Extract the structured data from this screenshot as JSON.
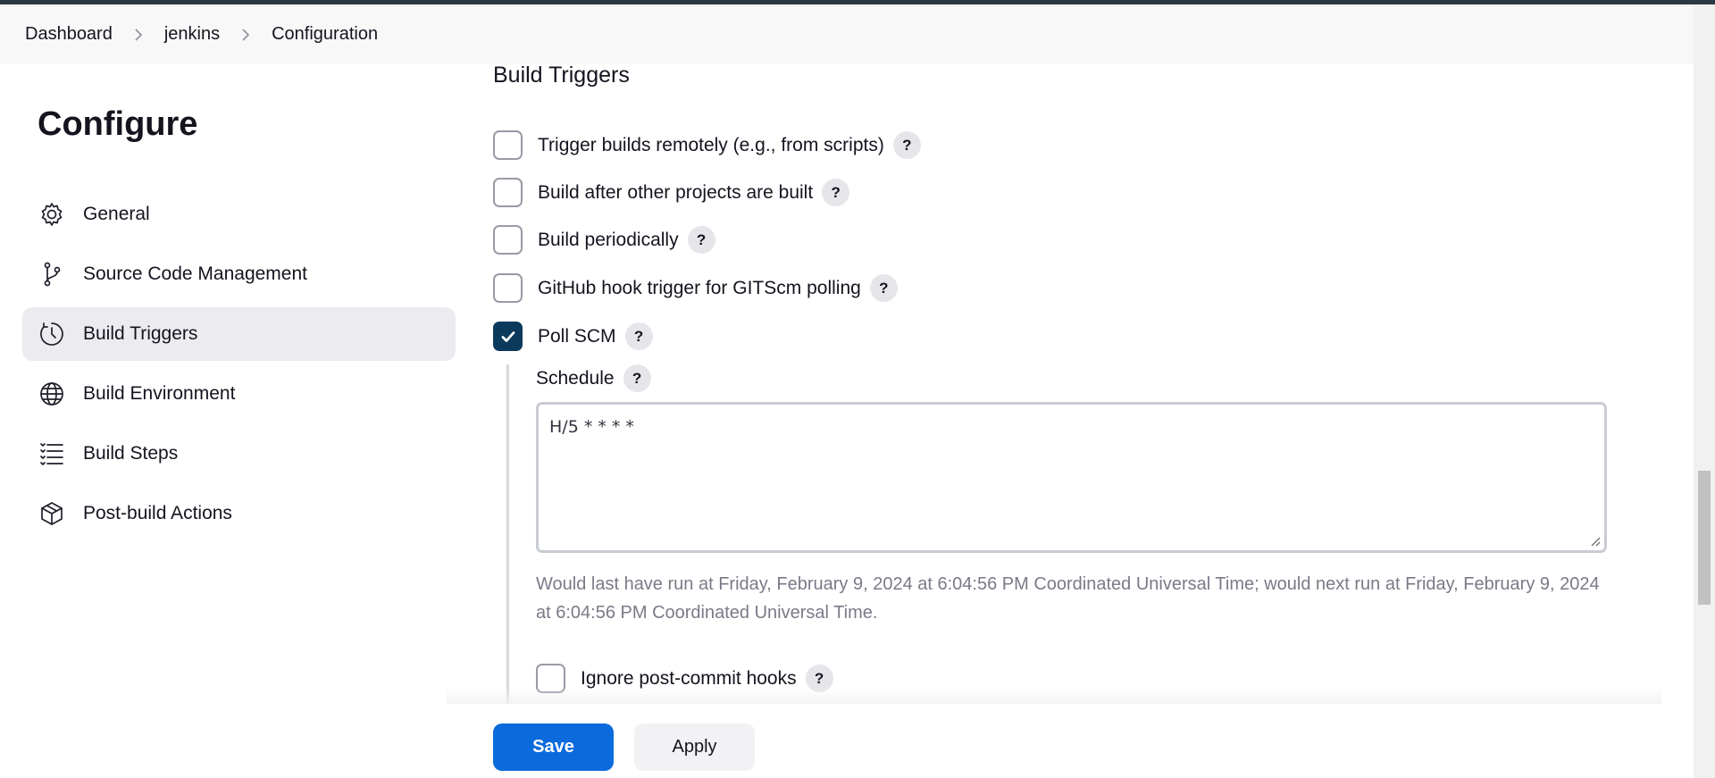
{
  "breadcrumb": {
    "items": [
      "Dashboard",
      "jenkins",
      "Configuration"
    ]
  },
  "sidebar": {
    "title": "Configure",
    "items": [
      {
        "label": "General",
        "icon": "gear-icon",
        "active": false
      },
      {
        "label": "Source Code Management",
        "icon": "branch-icon",
        "active": false
      },
      {
        "label": "Build Triggers",
        "icon": "clock-icon",
        "active": true
      },
      {
        "label": "Build Environment",
        "icon": "globe-icon",
        "active": false
      },
      {
        "label": "Build Steps",
        "icon": "list-icon",
        "active": false
      },
      {
        "label": "Post-build Actions",
        "icon": "package-icon",
        "active": false
      }
    ]
  },
  "main": {
    "section_title": "Build Triggers",
    "options": [
      {
        "label": "Trigger builds remotely (e.g., from scripts)",
        "checked": false
      },
      {
        "label": "Build after other projects are built",
        "checked": false
      },
      {
        "label": "Build periodically",
        "checked": false
      },
      {
        "label": "GitHub hook trigger for GITScm polling",
        "checked": false
      },
      {
        "label": "Poll SCM",
        "checked": true
      }
    ],
    "schedule": {
      "label": "Schedule",
      "value": "H/5 * * * *",
      "info": "Would last have run at Friday, February 9, 2024 at 6:04:56 PM Coordinated Universal Time; would next run at Friday, February 9, 2024 at 6:04:56 PM Coordinated Universal Time."
    },
    "ignore_hooks": {
      "label": "Ignore post-commit hooks",
      "checked": false
    },
    "help_symbol": "?"
  },
  "actions": {
    "save_label": "Save",
    "apply_label": "Apply"
  },
  "colors": {
    "accent": "#0b6bdc",
    "checked": "#0b3a5c",
    "active_nav": "#ececf0"
  }
}
